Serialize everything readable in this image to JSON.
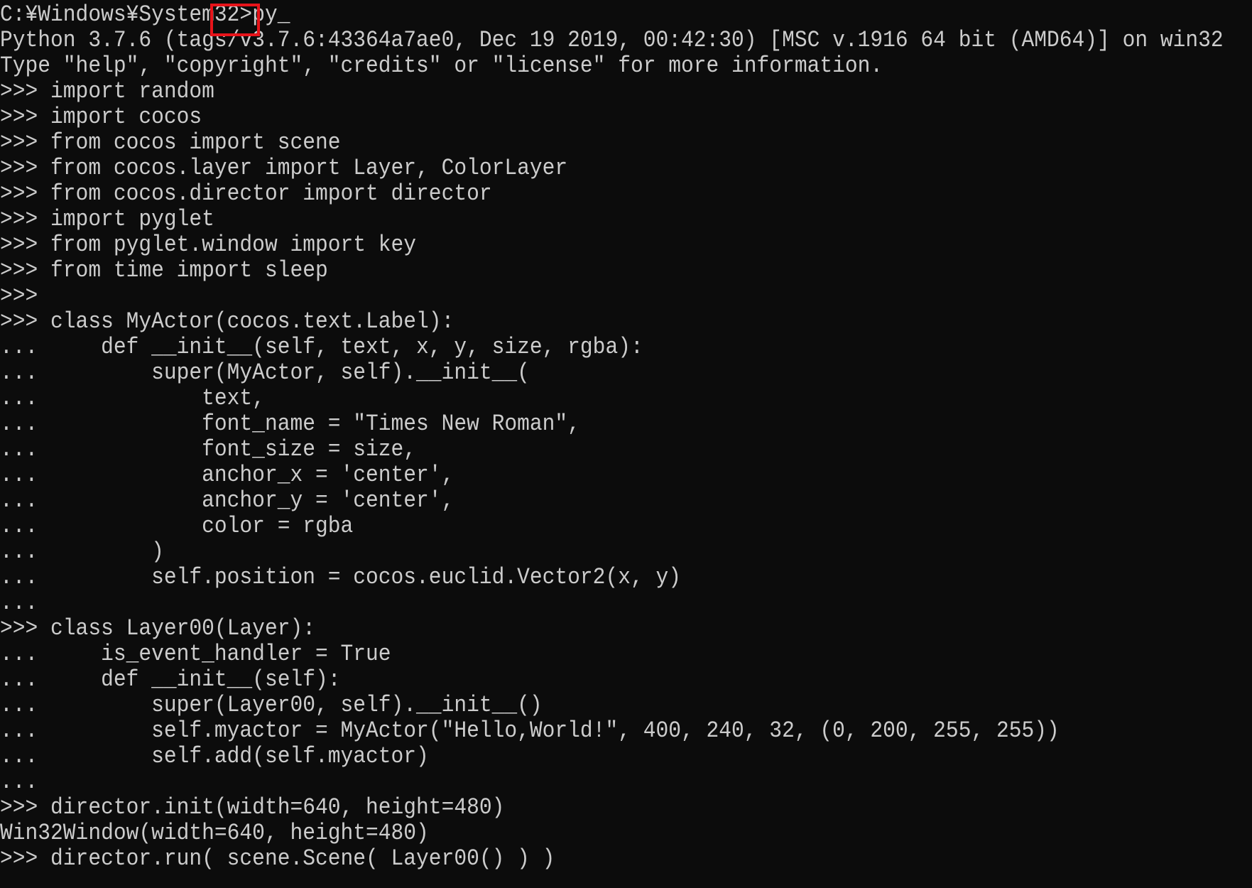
{
  "console": {
    "first_line": {
      "prompt": "C:¥Windows¥System32>",
      "command": "py",
      "cursor": "_"
    },
    "lines": [
      "Python 3.7.6 (tags/v3.7.6:43364a7ae0, Dec 19 2019, 00:42:30) [MSC v.1916 64 bit (AMD64)] on win32",
      "Type \"help\", \"copyright\", \"credits\" or \"license\" for more information.",
      ">>> import random",
      ">>> import cocos",
      ">>> from cocos import scene",
      ">>> from cocos.layer import Layer, ColorLayer",
      ">>> from cocos.director import director",
      ">>> import pyglet",
      ">>> from pyglet.window import key",
      ">>> from time import sleep",
      ">>>",
      ">>> class MyActor(cocos.text.Label):",
      "...     def __init__(self, text, x, y, size, rgba):",
      "...         super(MyActor, self).__init__(",
      "...             text,",
      "...             font_name = \"Times New Roman\",",
      "...             font_size = size,",
      "...             anchor_x = 'center',",
      "...             anchor_y = 'center',",
      "...             color = rgba",
      "...         )",
      "...         self.position = cocos.euclid.Vector2(x, y)",
      "...",
      ">>> class Layer00(Layer):",
      "...     is_event_handler = True",
      "...     def __init__(self):",
      "...         super(Layer00, self).__init__()",
      "...         self.myactor = MyActor(\"Hello,World!\", 400, 240, 32, (0, 200, 255, 255))",
      "...         self.add(self.myactor)",
      "...",
      ">>> director.init(width=640, height=480)",
      "Win32Window(width=640, height=480)",
      ">>> director.run( scene.Scene( Layer00() ) )"
    ]
  },
  "colors": {
    "background": "#0c0c0c",
    "text": "#cccccc",
    "highlight_box": "#e8141a"
  }
}
